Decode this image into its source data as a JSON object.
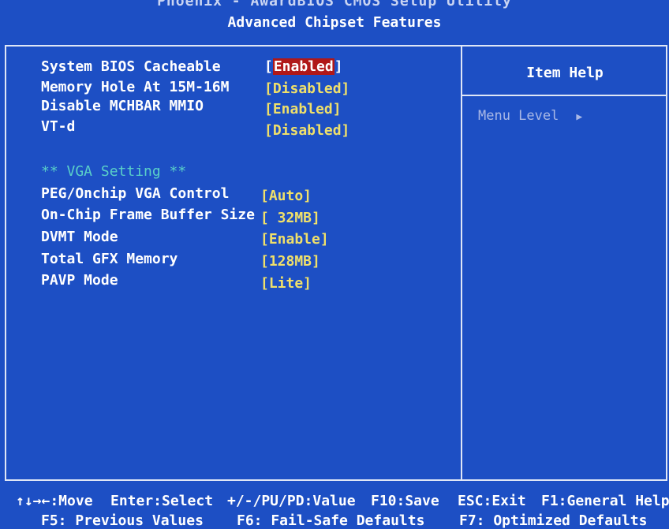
{
  "header": {
    "top": "Phoenix - AwardBIOS CMOS Setup Utility",
    "title": "Advanced Chipset Features"
  },
  "items": [
    {
      "label": "System BIOS Cacheable",
      "value": "Enabled"
    },
    {
      "label": "Memory Hole At 15M-16M",
      "value": "[Disabled]"
    },
    {
      "label": "Disable MCHBAR MMIO",
      "value": "[Enabled]"
    },
    {
      "label": "VT-d",
      "value": "[Disabled]"
    }
  ],
  "section": "** VGA Setting **",
  "vga_items": [
    {
      "label": "PEG/Onchip VGA Control",
      "value": "[Auto]"
    },
    {
      "label": "On-Chip Frame Buffer Size",
      "value": "[ 32MB]"
    },
    {
      "label": "DVMT Mode",
      "value": "[Enable]"
    },
    {
      "label": "Total GFX Memory",
      "value": "[128MB]"
    },
    {
      "label": "PAVP Mode",
      "value": "[Lite]"
    }
  ],
  "help": {
    "title": "Item Help",
    "menu_level": "Menu Level"
  },
  "footer": {
    "row1": [
      "↑↓→←:Move",
      "Enter:Select",
      "+/-/PU/PD:Value",
      "F10:Save",
      "ESC:Exit",
      "F1:General Help"
    ],
    "row2": [
      "F5: Previous Values",
      "F6: Fail-Safe Defaults",
      "F7: Optimized Defaults"
    ]
  },
  "colors": {
    "background": "#1d4fc4",
    "value": "#f0e06a",
    "highlight": "#b01818",
    "section": "#5ad0c8"
  }
}
